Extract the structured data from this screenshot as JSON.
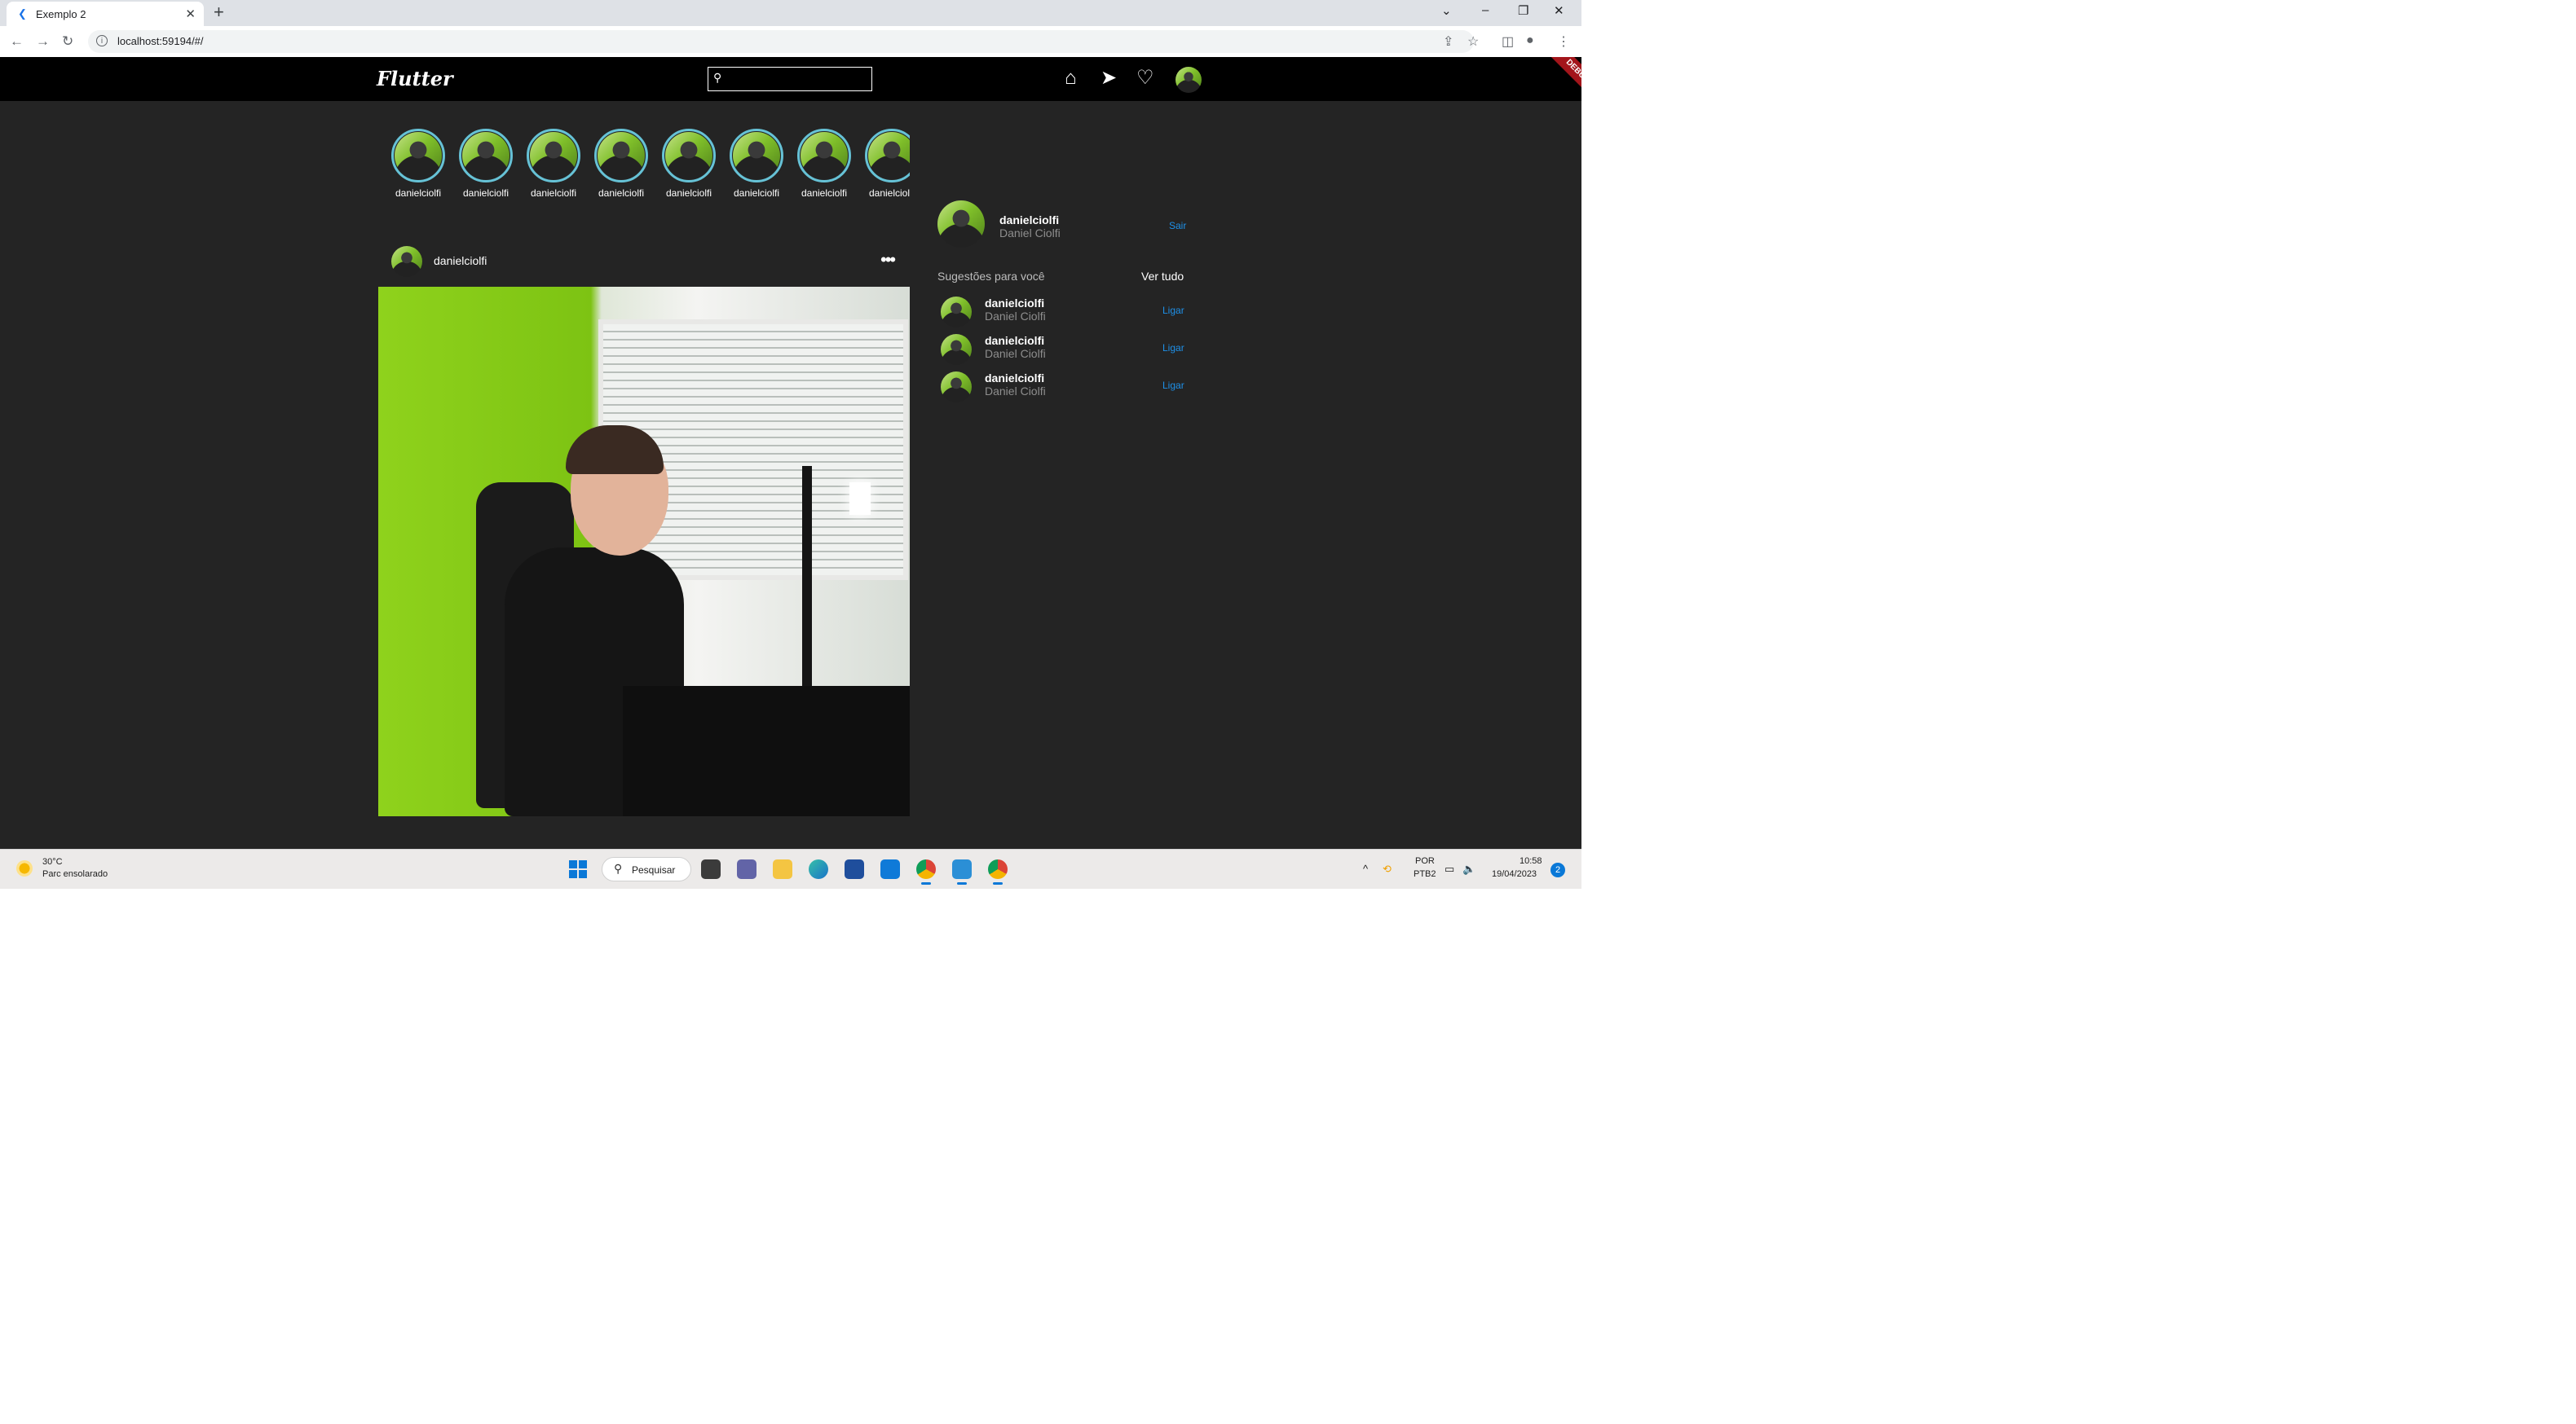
{
  "browser": {
    "tab_title": "Exemplo 2",
    "url": "localhost:59194/#/"
  },
  "appbar": {
    "logo": "Flutter",
    "search_placeholder": "",
    "debug_banner": "DEBUG"
  },
  "stories": [
    {
      "username": "danielciolfi"
    },
    {
      "username": "danielciolfi"
    },
    {
      "username": "danielciolfi"
    },
    {
      "username": "danielciolfi"
    },
    {
      "username": "danielciolfi"
    },
    {
      "username": "danielciolfi"
    },
    {
      "username": "danielciolfi"
    },
    {
      "username": "danielciolfi"
    }
  ],
  "post": {
    "username": "danielciolfi",
    "more": "•••"
  },
  "profile": {
    "username": "danielciolfi",
    "name": "Daniel Ciolfi",
    "logout_label": "Sair"
  },
  "suggestions": {
    "title": "Sugestões para você",
    "see_all": "Ver tudo",
    "items": [
      {
        "username": "danielciolfi",
        "name": "Daniel Ciolfi",
        "action": "Ligar"
      },
      {
        "username": "danielciolfi",
        "name": "Daniel Ciolfi",
        "action": "Ligar"
      },
      {
        "username": "danielciolfi",
        "name": "Daniel Ciolfi",
        "action": "Ligar"
      }
    ]
  },
  "taskbar": {
    "weather_temp": "30°C",
    "weather_desc": "Parc ensolarado",
    "search_label": "Pesquisar",
    "lang_1": "POR",
    "lang_2": "PTB2",
    "time": "10:58",
    "date": "19/04/2023",
    "notifications": "2"
  },
  "colors": {
    "app_background": "#242424",
    "appbar": "#000000",
    "link": "#1e90e8",
    "story_ring": "#66c2d6"
  }
}
